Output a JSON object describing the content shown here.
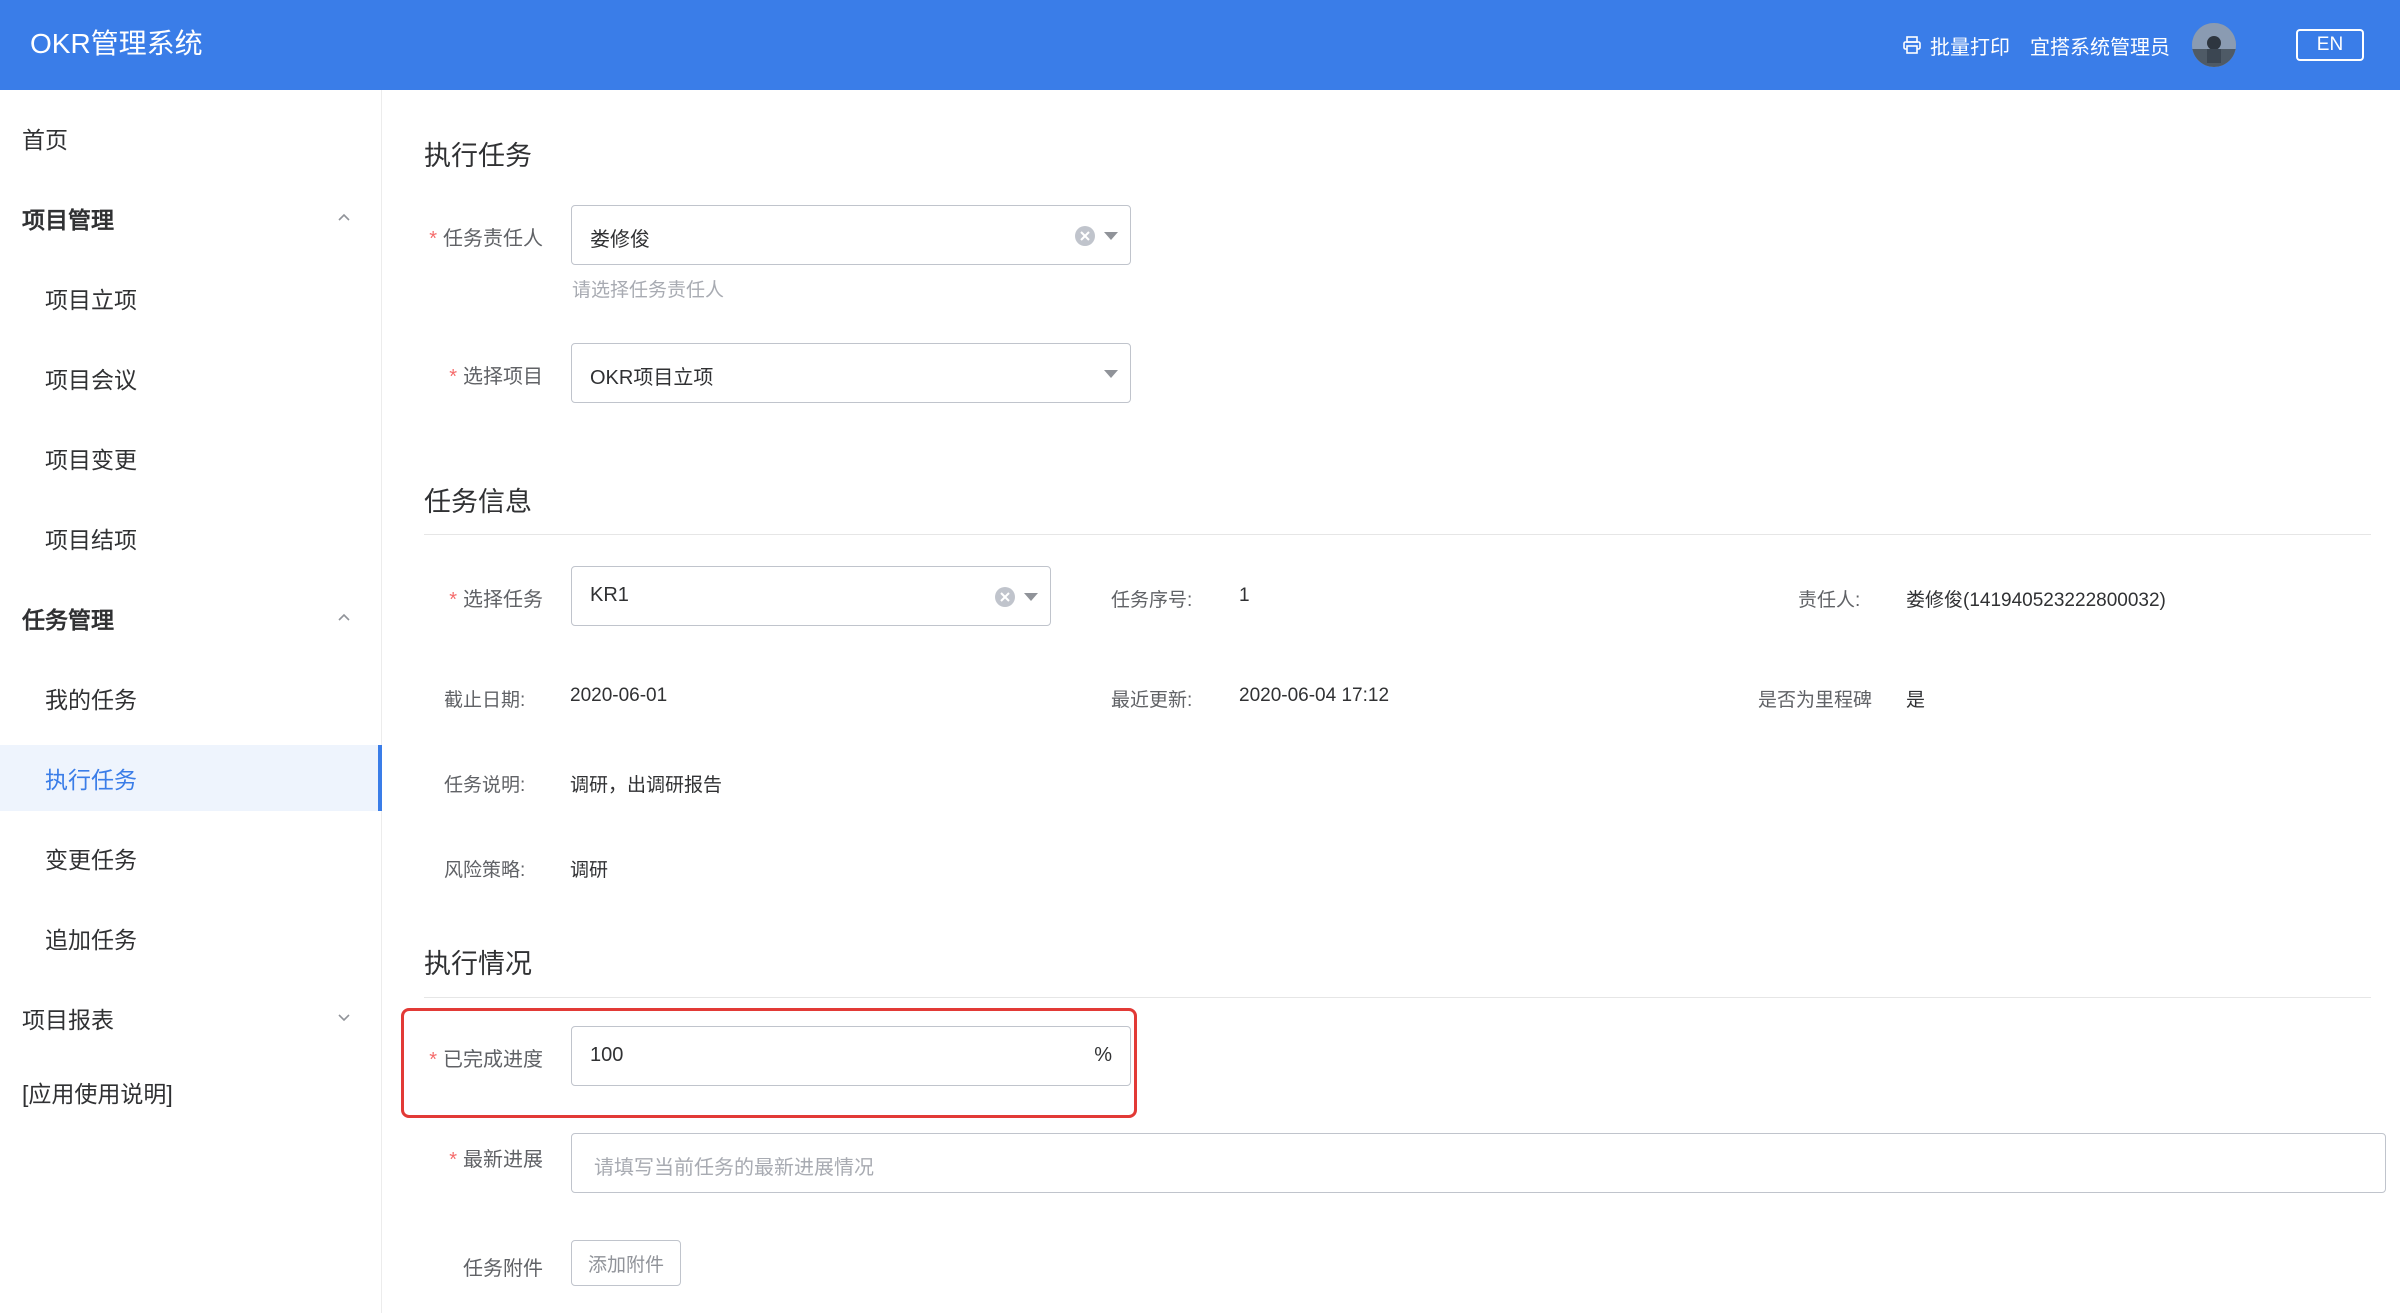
{
  "header": {
    "app_title": "OKR管理系统",
    "print_label": "批量打印",
    "admin_name": "宜搭系统管理员",
    "lang_label": "EN",
    "bg_color": "#3a7de8"
  },
  "sidebar": {
    "home": "首页",
    "project_mgmt": "项目管理",
    "project_items": [
      "项目立项",
      "项目会议",
      "项目变更",
      "项目结项"
    ],
    "task_mgmt": "任务管理",
    "task_items": [
      "我的任务",
      "执行任务",
      "变更任务",
      "追加任务"
    ],
    "active_item": "执行任务",
    "project_report": "项目报表",
    "app_guide": "[应用使用说明]"
  },
  "sections": {
    "exec_task": "执行任务",
    "task_info": "任务信息",
    "exec_status": "执行情况"
  },
  "form": {
    "required_mark": "*",
    "owner_label": "任务责任人",
    "owner_value": "娄修俊",
    "owner_hint": "请选择任务责任人",
    "project_label": "选择项目",
    "project_value": "OKR项目立项",
    "task_label": "选择任务",
    "task_value": "KR1",
    "progress_label": "已完成进度",
    "progress_value": "100",
    "progress_unit": "%",
    "latest_label": "最新进展",
    "latest_placeholder": "请填写当前任务的最新进展情况",
    "attach_label": "任务附件",
    "attach_button": "添加附件"
  },
  "task_info": {
    "seq_label": "任务序号:",
    "seq_value": "1",
    "owner_label": "责任人:",
    "owner_value": "娄修俊(141940523222800032)",
    "deadline_label": "截止日期:",
    "deadline_value": "2020-06-01",
    "updated_label": "最近更新:",
    "updated_value": "2020-06-04 17:12",
    "milestone_label": "是否为里程碑",
    "milestone_value": "是",
    "desc_label": "任务说明:",
    "desc_value": "调研，出调研报告",
    "risk_label": "风险策略:",
    "risk_value": "调研"
  }
}
